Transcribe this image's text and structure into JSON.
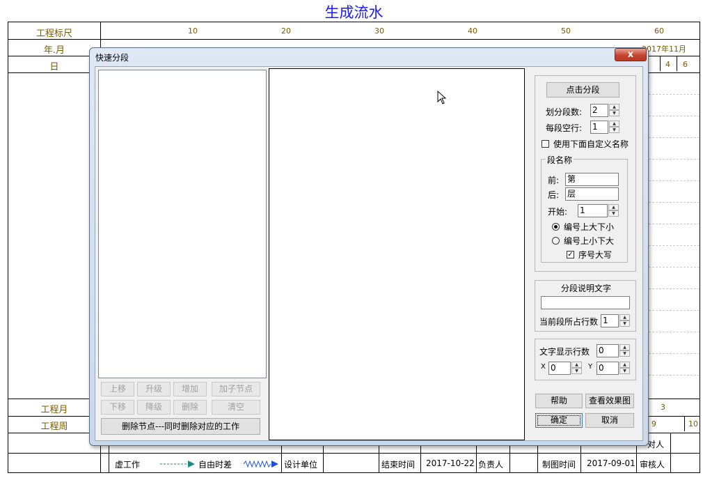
{
  "page_title": "生成流水",
  "schedule": {
    "row_labels": [
      "工程标尺",
      "年.月",
      "日",
      "工程月",
      "工程周"
    ],
    "scale_ticks": [
      "10",
      "20",
      "30",
      "40",
      "50",
      "60"
    ],
    "months": [
      "2017年11月"
    ],
    "day_cells": [
      "4",
      "6"
    ],
    "eng_month_value": "3",
    "eng_week_values": [
      "9",
      "10"
    ],
    "footer": {
      "virtual_work": "虚工作",
      "free_float": "自由时差",
      "design_unit": "设计单位",
      "end_time_label": "结束时间",
      "end_time_value": "2017-10-22",
      "responsible": "负责人",
      "drawing_time_label": "制图时间",
      "drawing_time_value": "2017-09-01",
      "reviewer": "审核人",
      "approver_partial": "对人"
    }
  },
  "dialog": {
    "title": "快速分段",
    "close_symbol": "x",
    "left_buttons": {
      "move_up": "上移",
      "promote": "升级",
      "add": "增加",
      "add_child": "加子节点",
      "move_down": "下移",
      "demote": "降级",
      "delete": "删除",
      "clear": "清空",
      "delete_node": "删除节点---同时删除对应的工作"
    },
    "segment": {
      "split_button": "点击分段",
      "count_label": "划分段数:",
      "count_value": "2",
      "blank_label": "每段空行:",
      "blank_value": "1",
      "use_custom_label": "使用下面自定义名称",
      "use_custom_checked": false
    },
    "name_group": {
      "legend": "段名称",
      "prefix_label": "前:",
      "prefix_value": "第",
      "suffix_label": "后:",
      "suffix_value": "层",
      "start_label": "开始:",
      "start_value": "1",
      "radio_big_small": "编号上大下小",
      "radio_small_big": "编号上小下大",
      "selected_radio": "编号上大下小",
      "uppercase_label": "序号大写",
      "uppercase_checked": true
    },
    "desc_group": {
      "title": "分段说明文字",
      "text_value": "",
      "rows_label": "当前段所占行数",
      "rows_value": "1"
    },
    "display_group": {
      "rows_label": "文字显示行数",
      "rows_value": "0",
      "x_label": "X",
      "x_value": "0",
      "y_label": "Y",
      "y_value": "0"
    },
    "bottom_buttons": {
      "help": "帮助",
      "preview": "查看效果图",
      "ok": "确定",
      "cancel": "取消"
    }
  }
}
